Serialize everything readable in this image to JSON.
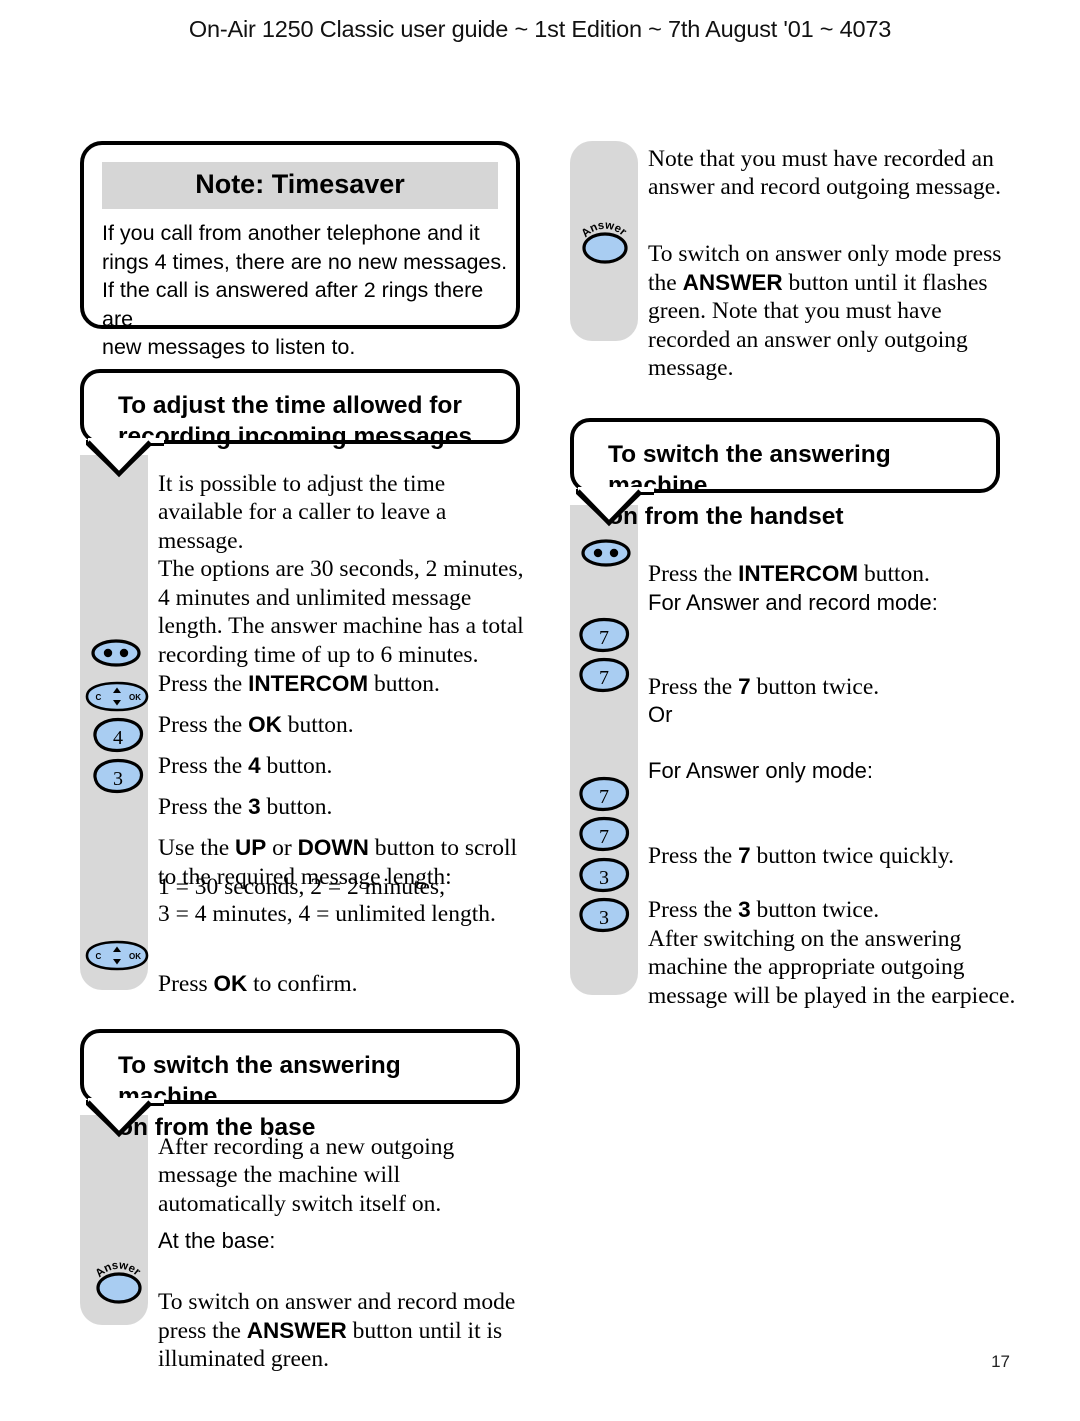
{
  "header": {
    "running_head": "On-Air 1250 Classic user guide ~ 1st Edition ~ 7th August '01 ~ 4073",
    "page_number": "17"
  },
  "colors": {
    "key_blue": "#a9cdf2",
    "rail_grey": "#d8d8d8",
    "note_title_grey": "#d6d6d6",
    "outline": "#000000"
  },
  "note_box": {
    "title": "Note: Timesaver",
    "body": "If you call from another telephone and it\nrings 4 times, there are no new messages.\nIf the call is answered after 2 rings there are\nnew messages to listen to."
  },
  "left_column": {
    "section1": {
      "heading": "To adjust the time allowed for\nrecording incoming messages",
      "intro": "It is possible to adjust the time\navailable for a caller to leave a message.\nThe options are 30 seconds, 2 minutes,\n4 minutes and unlimited message\nlength. The answer machine has a total\nrecording time of up to 6 minutes.",
      "steps": [
        {
          "key": "intercom",
          "key_label": "",
          "text_before": "Press the ",
          "bold": "INTERCOM",
          "text_after": " button."
        },
        {
          "key": "ok",
          "key_label": "",
          "text_before": "Press the ",
          "bold": "OK",
          "text_after": " button."
        },
        {
          "key": "num",
          "key_label": "4",
          "text_before": "Press the ",
          "bold": "4",
          "text_after": " button."
        },
        {
          "key": "num",
          "key_label": "3",
          "text_before": "Press the ",
          "bold": "3",
          "text_after": " button."
        }
      ],
      "scroll_instruction_1": "Use the ",
      "scroll_bold_1": "UP",
      "scroll_instruction_2": " or ",
      "scroll_bold_2": "DOWN",
      "scroll_instruction_3": " button to scroll\nto the required message length:",
      "options": "1 = 30 seconds, 2 = 2 minutes,\n3 = 4 minutes, 4 = unlimited length.",
      "confirm_before": "Press ",
      "confirm_bold": "OK",
      "confirm_after": " to confirm."
    },
    "section2": {
      "heading": "To switch the answering machine\non from the base",
      "intro": "After recording a new outgoing\nmessage the machine will\nautomatically switch itself on.",
      "subhead": "At the base:",
      "answer_before": "To switch on answer and record mode\npress the ",
      "answer_bold": "ANSWER",
      "answer_after": " button until it is\nilluminated green.",
      "answer_key_label": "Answer"
    }
  },
  "right_column": {
    "top_note": {
      "para1": "Note that you must have recorded an\nanswer and record outgoing message.",
      "para2_before": "To switch on answer only mode press\nthe ",
      "para2_bold": "ANSWER",
      "para2_after": " button until it flashes\ngreen. Note that you must have\nrecorded an answer only outgoing\nmessage.",
      "answer_key_label": "Answer"
    },
    "section1": {
      "heading": "To switch the answering machine\non from the handset",
      "steps": [
        {
          "key": "intercom",
          "key_label": "",
          "text_before": "Press the ",
          "bold": "INTERCOM",
          "text_after": " button."
        }
      ],
      "label_answer_record": "For Answer and record mode:",
      "press7_before": "Press the ",
      "press7_bold": "7",
      "press7_after": " button twice.",
      "or": "Or",
      "label_answer_only": "For Answer only mode:",
      "press7q_before": "Press the ",
      "press7q_bold": "7",
      "press7q_after": " button twice quickly.",
      "press3_before": "Press the ",
      "press3_bold": "3",
      "press3_after": " button twice.",
      "outro": "After switching on the answering\nmachine the appropriate outgoing\nmessage will be played in the earpiece.",
      "key_7a": "7",
      "key_7b": "7",
      "key_7c": "7",
      "key_7d": "7",
      "key_3a": "3",
      "key_3b": "3"
    }
  },
  "icons": {
    "intercom": "intercom-two-dot-key",
    "ok": "ok-navigation-key",
    "number": "number-key",
    "answer": "answer-key"
  }
}
